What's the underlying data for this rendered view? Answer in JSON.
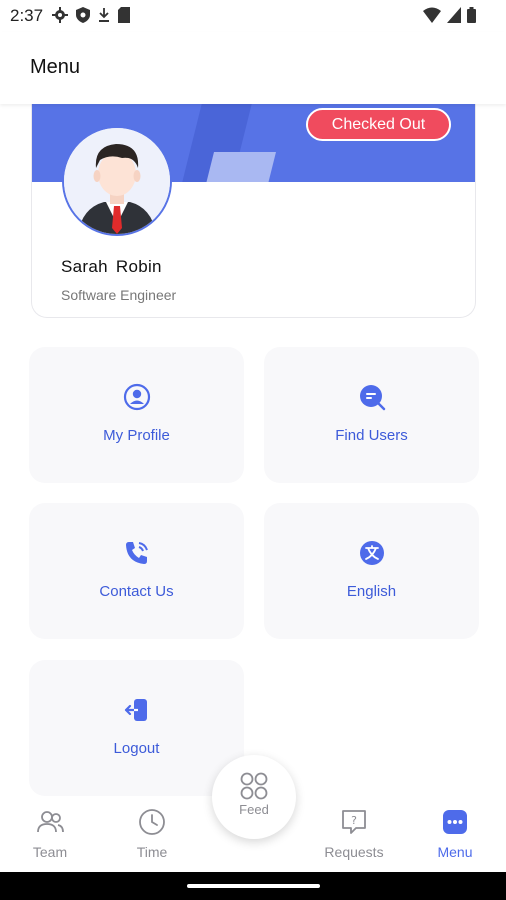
{
  "status_bar": {
    "time": "2:37",
    "left_icons": [
      "gear-icon",
      "shield-icon",
      "download-icon",
      "sd-card-icon"
    ],
    "right_icons": [
      "wifi-icon",
      "cell-signal-icon",
      "battery-icon"
    ]
  },
  "header": {
    "title": "Menu"
  },
  "profile": {
    "status_badge": "Checked Out",
    "name": "Sarah  Robin",
    "role": "Software Engineer",
    "banner_color": "#5773e6",
    "badge_color": "#f04b5e"
  },
  "menu_tiles": [
    {
      "label": "My Profile",
      "icon": "user-circle-icon"
    },
    {
      "label": "Find Users",
      "icon": "search-chat-icon"
    },
    {
      "label": "Contact Us",
      "icon": "phone-ringing-icon"
    },
    {
      "label": "English",
      "icon": "language-icon"
    },
    {
      "label": "Logout",
      "icon": "logout-icon"
    }
  ],
  "bottom_nav": {
    "items": [
      {
        "label": "Team",
        "icon": "users-icon",
        "active": false
      },
      {
        "label": "Time",
        "icon": "clock-icon",
        "active": false
      },
      {
        "label": "Feed",
        "icon": "grid-icon",
        "active": false
      },
      {
        "label": "Requests",
        "icon": "help-bubble-icon",
        "active": false
      },
      {
        "label": "Menu",
        "icon": "menu-dots-icon",
        "active": true
      }
    ]
  },
  "colors": {
    "accent": "#4e6bea",
    "tile_text": "#3d5bd9",
    "inactive": "#8d8d93"
  }
}
